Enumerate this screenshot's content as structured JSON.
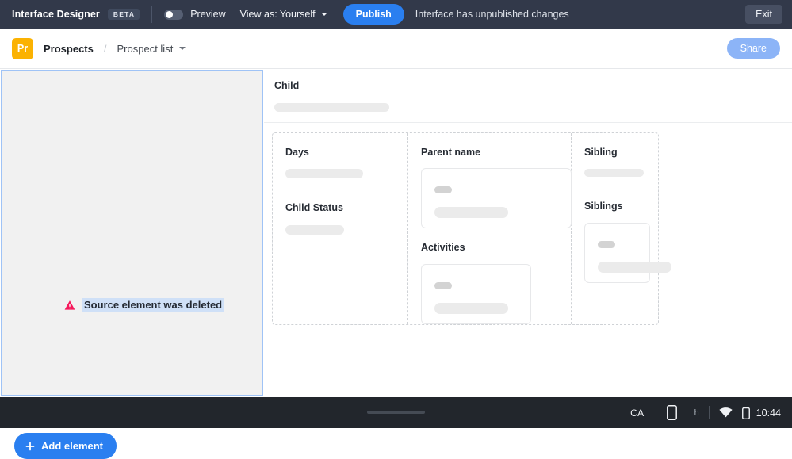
{
  "topbar": {
    "app_title": "Interface Designer",
    "beta_badge": "BETA",
    "preview_label": "Preview",
    "preview_toggle_state": "off",
    "view_as_label": "View as: Yourself",
    "publish_label": "Publish",
    "unpublished_message": "Interface has unpublished changes",
    "exit_label": "Exit",
    "bg_color": "#32394a",
    "publish_color": "#2a7ff0"
  },
  "breadcrumb": {
    "logo_text": "Pr",
    "logo_color": "#fbb202",
    "root_label": "Prospects",
    "separator": "/",
    "current_label": "Prospect list",
    "share_label": "Share",
    "share_color": "#8cb4f7"
  },
  "left_panel": {
    "error_text": "Source element was deleted",
    "error_icon": "warning-triangle-icon",
    "error_icon_color": "#f5185b",
    "add_element_label": "Add element",
    "add_element_color": "#2a7ff0",
    "selection_border_color": "#9fc3f6"
  },
  "main": {
    "child_section": {
      "label": "Child"
    },
    "columns": [
      {
        "id": "days",
        "fields": [
          {
            "label": "Days",
            "type": "skeleton-line"
          },
          {
            "label": "Child Status",
            "type": "skeleton-line"
          }
        ]
      },
      {
        "id": "parent",
        "fields": [
          {
            "label": "Parent name",
            "type": "card"
          },
          {
            "label": "Activities",
            "type": "card"
          }
        ]
      },
      {
        "id": "sibling",
        "fields": [
          {
            "label": "Sibling",
            "type": "skeleton-line"
          },
          {
            "label": "Siblings",
            "type": "card"
          }
        ]
      }
    ]
  },
  "bottombar": {
    "locale": "CA",
    "device_icon": "phone-icon",
    "letter": "h",
    "wifi_icon": "wifi-icon",
    "battery_icon": "battery-icon",
    "time": "10:44",
    "bg_color": "#22262c"
  }
}
